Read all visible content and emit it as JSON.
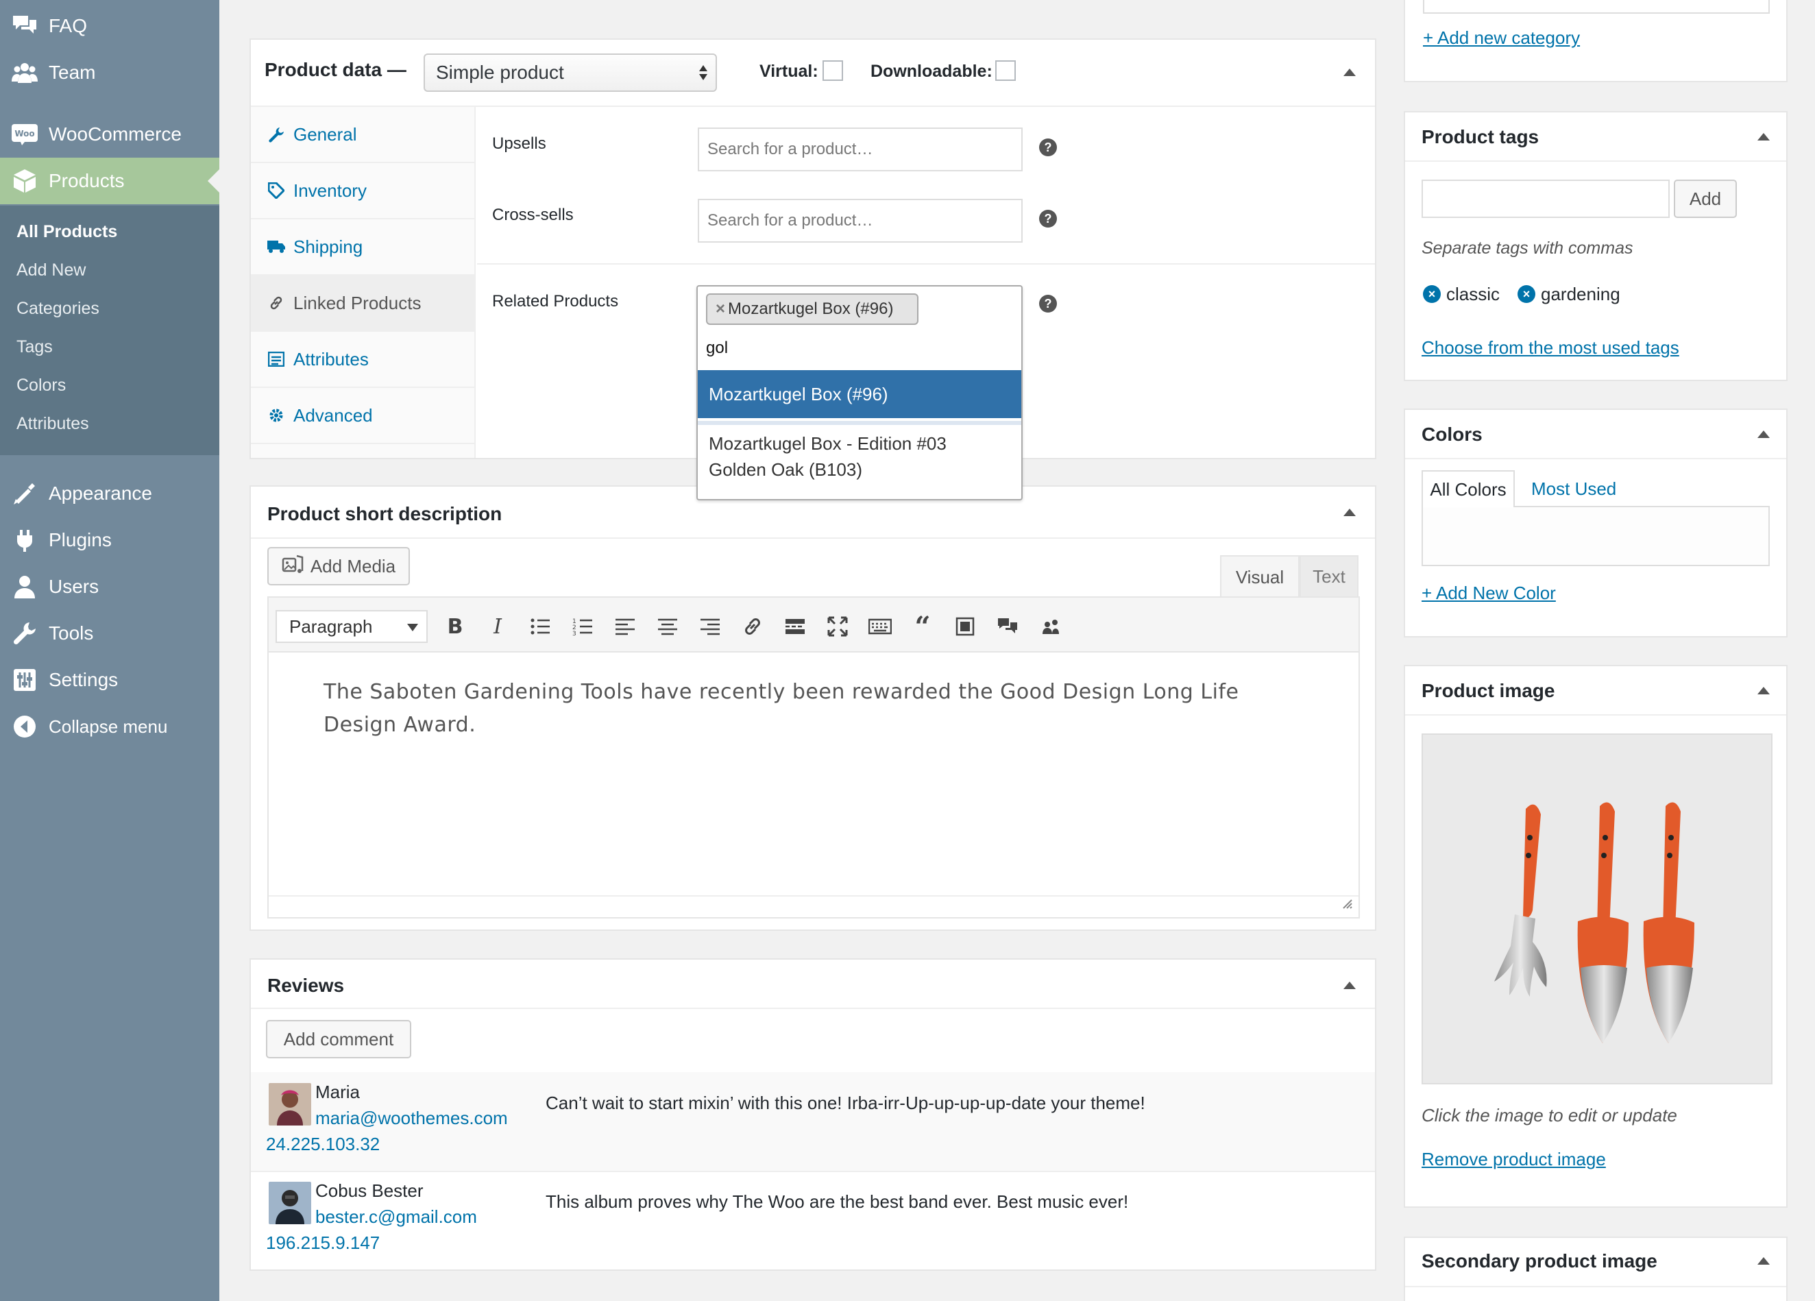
{
  "sidebar": {
    "top_items": [
      {
        "label": "FAQ",
        "icon": "faq-icon"
      },
      {
        "label": "Team",
        "icon": "team-icon"
      }
    ],
    "woocommerce_label": "WooCommerce",
    "products_label": "Products",
    "submenu": [
      "All Products",
      "Add New",
      "Categories",
      "Tags",
      "Colors",
      "Attributes"
    ],
    "bottom_items": [
      {
        "label": "Appearance",
        "icon": "appearance-icon"
      },
      {
        "label": "Plugins",
        "icon": "plugins-icon"
      },
      {
        "label": "Users",
        "icon": "users-icon"
      },
      {
        "label": "Tools",
        "icon": "tools-icon"
      },
      {
        "label": "Settings",
        "icon": "settings-icon"
      },
      {
        "label": "Collapse menu",
        "icon": "collapse-icon"
      }
    ]
  },
  "product_data": {
    "title": "Product data —",
    "type_value": "Simple product",
    "virtual_label": "Virtual:",
    "downloadable_label": "Downloadable:",
    "tabs": [
      "General",
      "Inventory",
      "Shipping",
      "Linked Products",
      "Attributes",
      "Advanced"
    ],
    "active_tab": "Linked Products",
    "upsells_label": "Upsells",
    "upsells_placeholder": "Search for a product…",
    "crosssells_label": "Cross-sells",
    "crosssells_placeholder": "Search for a product…",
    "related_label": "Related Products",
    "related_token": "Mozartkugel Box (#96)",
    "related_query": "gol",
    "dropdown": {
      "highlighted": "Mozartkugel Box (#96)",
      "option_line1": "Mozartkugel Box - Edition #03",
      "option_line2": "Golden Oak (B103)"
    }
  },
  "short_description": {
    "title": "Product short description",
    "add_media": "Add Media",
    "tab_visual": "Visual",
    "tab_text": "Text",
    "format_value": "Paragraph",
    "content": "The Saboten Gardening Tools have recently been rewarded the Good Design Long Life Design Award."
  },
  "reviews": {
    "title": "Reviews",
    "add_comment": "Add comment",
    "items": [
      {
        "name": "Maria",
        "email": "maria@woothemes.com",
        "ip": "24.225.103.32",
        "text": "Can’t wait to start mixin’ with this one! Irba-irr-Up-up-up-up-date your theme!"
      },
      {
        "name": "Cobus Bester",
        "email": "bester.c@gmail.com",
        "ip": "196.215.9.147",
        "text": "This album proves why The Woo are the best band ever. Best music ever!"
      }
    ]
  },
  "right": {
    "add_category": "+ Add new category",
    "tags": {
      "title": "Product tags",
      "add_button": "Add",
      "hint": "Separate tags with commas",
      "items": [
        "classic",
        "gardening"
      ],
      "choose_link": "Choose from the most used tags"
    },
    "colors": {
      "title": "Colors",
      "tab_all": "All Colors",
      "tab_most": "Most Used",
      "add_link": "+ Add New Color"
    },
    "product_image": {
      "title": "Product image",
      "hint": "Click the image to edit or update",
      "remove_link": "Remove product image"
    },
    "secondary_image": {
      "title": "Secondary product image"
    }
  },
  "colors": {
    "sidebar_bg": "#72899b",
    "sidebar_sub_bg": "#5e7686",
    "active_menu": "#a6c79b",
    "link": "#0073aa",
    "dropdown_highlight": "#3071a9",
    "tool_orange": "#e25a2a"
  }
}
